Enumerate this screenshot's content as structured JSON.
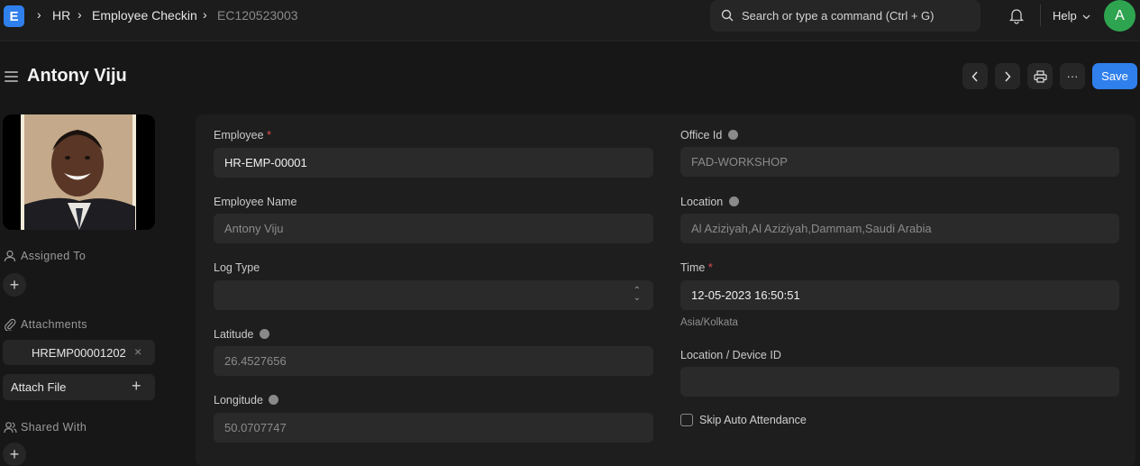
{
  "navbar": {
    "logo_letter": "E",
    "breadcrumbs": [
      "HR",
      "Employee Checkin",
      "EC120523003"
    ],
    "search_placeholder": "Search or type a command (Ctrl + G)",
    "help_label": "Help",
    "avatar_letter": "A"
  },
  "header": {
    "title": "Antony Viju",
    "save_label": "Save",
    "more_label": "···"
  },
  "sidebar": {
    "assigned_to_label": "Assigned To",
    "attachments_label": "Attachments",
    "attachment_name": "HREMP00001202",
    "attach_file_label": "Attach File",
    "shared_with_label": "Shared With"
  },
  "form": {
    "employee_label": "Employee",
    "employee_value": "HR-EMP-00001",
    "employee_name_label": "Employee Name",
    "employee_name_value": "Antony Viju",
    "log_type_label": "Log Type",
    "log_type_value": "",
    "latitude_label": "Latitude",
    "latitude_value": "26.4527656",
    "longitude_label": "Longitude",
    "longitude_value": "50.0707747",
    "office_id_label": "Office Id",
    "office_id_value": "FAD-WORKSHOP",
    "location_label": "Location",
    "location_value": "Al Aziziyah,Al Aziziyah,Dammam,Saudi Arabia",
    "time_label": "Time",
    "time_value": "12-05-2023 16:50:51",
    "timezone_note": "Asia/Kolkata",
    "device_label": "Location / Device ID",
    "device_value": "",
    "skip_auto_label": "Skip Auto Attendance",
    "required_mark": "*"
  },
  "colors": {
    "accent": "#2f80ed",
    "avatar": "#2fa450",
    "required": "#e24c4c"
  }
}
